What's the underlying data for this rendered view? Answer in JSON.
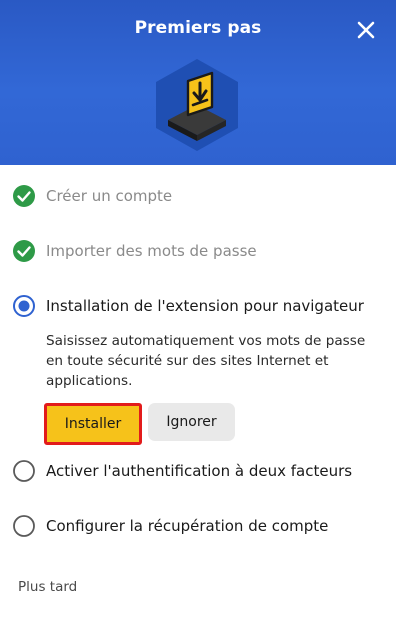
{
  "header": {
    "title": "Premiers pas",
    "close_icon": "close-icon",
    "hero_icon": "monitor-download-icon"
  },
  "steps": [
    {
      "label": "Créer un compte",
      "status": "done",
      "icon": "check-circle-icon"
    },
    {
      "label": "Importer des mots de passe",
      "status": "done",
      "icon": "check-circle-icon"
    },
    {
      "label": "Installation de l'extension pour navigateur",
      "status": "active",
      "icon": "radio-selected-icon"
    },
    {
      "label": "Activer l'authentification à deux facteurs",
      "status": "todo",
      "icon": "radio-empty-icon"
    },
    {
      "label": "Configurer la récupération de compte",
      "status": "todo",
      "icon": "radio-empty-icon"
    }
  ],
  "active_step": {
    "description_lines": [
      "Saisissez automatiquement vos mots de passe",
      "en toute sécurité sur des sites Internet et",
      "applications."
    ],
    "install_label": "Installer",
    "ignore_label": "Ignorer"
  },
  "footer": {
    "later_label": "Plus tard"
  },
  "colors": {
    "header_blue": "#2f62d0",
    "check_green": "#2e9a47",
    "radio_blue": "#2f62d0",
    "install_yellow": "#f6c21a",
    "highlight_red": "#e21b1b",
    "ignore_gray": "#e9e9e9"
  }
}
